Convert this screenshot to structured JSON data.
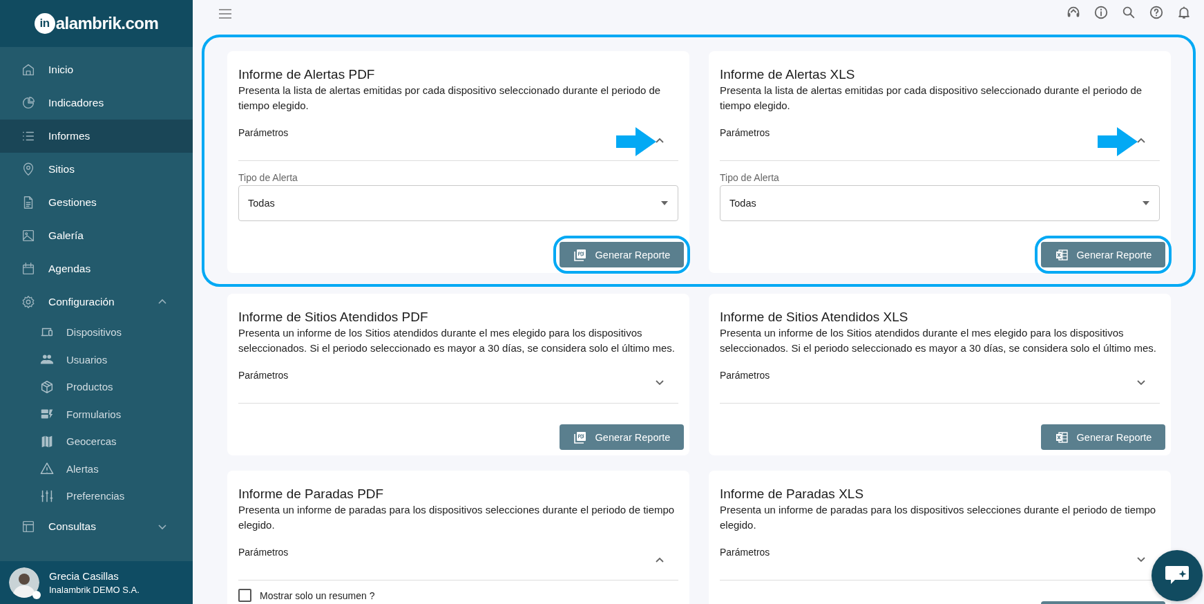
{
  "sidebar": {
    "logo": {
      "mark": "in",
      "text": "alambrik.com"
    },
    "items": [
      {
        "label": "Inicio",
        "selected": false
      },
      {
        "label": "Indicadores",
        "selected": false
      },
      {
        "label": "Informes",
        "selected": true
      },
      {
        "label": "Sitios",
        "selected": false
      },
      {
        "label": "Gestiones",
        "selected": false
      },
      {
        "label": "Galería",
        "selected": false
      },
      {
        "label": "Agendas",
        "selected": false
      },
      {
        "label": "Configuración",
        "selected": false,
        "expanded": true,
        "children": [
          {
            "label": "Dispositivos",
            "selected": false
          },
          {
            "label": "Usuarios",
            "selected": false
          },
          {
            "label": "Productos",
            "selected": false
          },
          {
            "label": "Formularios",
            "selected": false
          },
          {
            "label": "Geocercas",
            "selected": false
          },
          {
            "label": "Alertas",
            "selected": false
          },
          {
            "label": "Preferencias",
            "selected": false
          }
        ]
      },
      {
        "label": "Consultas",
        "selected": false,
        "expanded": false
      }
    ],
    "user": {
      "name": "Grecia Casillas",
      "company": "Inalambrik DEMO S.A.",
      "online": true
    }
  },
  "rows": [
    {
      "highlighted": true,
      "cards": [
        {
          "title": "Informe de Alertas PDF",
          "description": "Presenta la lista de alertas emitidas por cada dispositivo seleccionado durante el periodo de tiempo elegido.",
          "params_label": "Parámetros",
          "expanded": true,
          "arrow": true,
          "select": {
            "label": "Tipo de Alerta",
            "value": "Todas"
          },
          "button": {
            "label": "Generar Reporte",
            "kind": "pdf",
            "circled": true
          }
        },
        {
          "title": "Informe de Alertas XLS",
          "description": "Presenta la lista de alertas emitidas por cada dispositivo seleccionado durante el periodo de tiempo elegido.",
          "params_label": "Parámetros",
          "expanded": true,
          "arrow": true,
          "select": {
            "label": "Tipo de Alerta",
            "value": "Todas"
          },
          "button": {
            "label": "Generar Reporte",
            "kind": "xls",
            "circled": true
          }
        }
      ]
    },
    {
      "highlighted": false,
      "cards": [
        {
          "title": "Informe de Sitios Atendidos PDF",
          "description": "Presenta un informe de los Sitios atendidos durante el mes elegido para los dispositivos seleccionados. Si el periodo seleccionado es mayor a 30 días, se considera solo el último mes.",
          "params_label": "Parámetros",
          "expanded": false,
          "arrow": false,
          "button": {
            "label": "Generar Reporte",
            "kind": "pdf",
            "circled": false
          }
        },
        {
          "title": "Informe de Sitios Atendidos XLS",
          "description": "Presenta un informe de los Sitios atendidos durante el mes elegido para los dispositivos seleccionados. Si el periodo seleccionado es mayor a 30 días, se considera solo el último mes.",
          "params_label": "Parámetros",
          "expanded": false,
          "arrow": false,
          "button": {
            "label": "Generar Reporte",
            "kind": "xls",
            "circled": false
          }
        }
      ]
    },
    {
      "highlighted": false,
      "cards": [
        {
          "title": "Informe de Paradas PDF",
          "description": "Presenta un informe de paradas para los dispositivos selecciones durante el periodo de tiempo elegido.",
          "params_label": "Parámetros",
          "expanded": true,
          "arrow": false,
          "checkbox": {
            "label": "Mostrar solo un resumen ?",
            "checked": false
          }
        },
        {
          "title": "Informe de Paradas XLS",
          "description": "Presenta un informe de paradas para los dispositivos selecciones durante el periodo de tiempo elegido.",
          "params_label": "Parámetros",
          "expanded": false,
          "arrow": false,
          "button": {
            "circled": false
          }
        }
      ]
    }
  ]
}
